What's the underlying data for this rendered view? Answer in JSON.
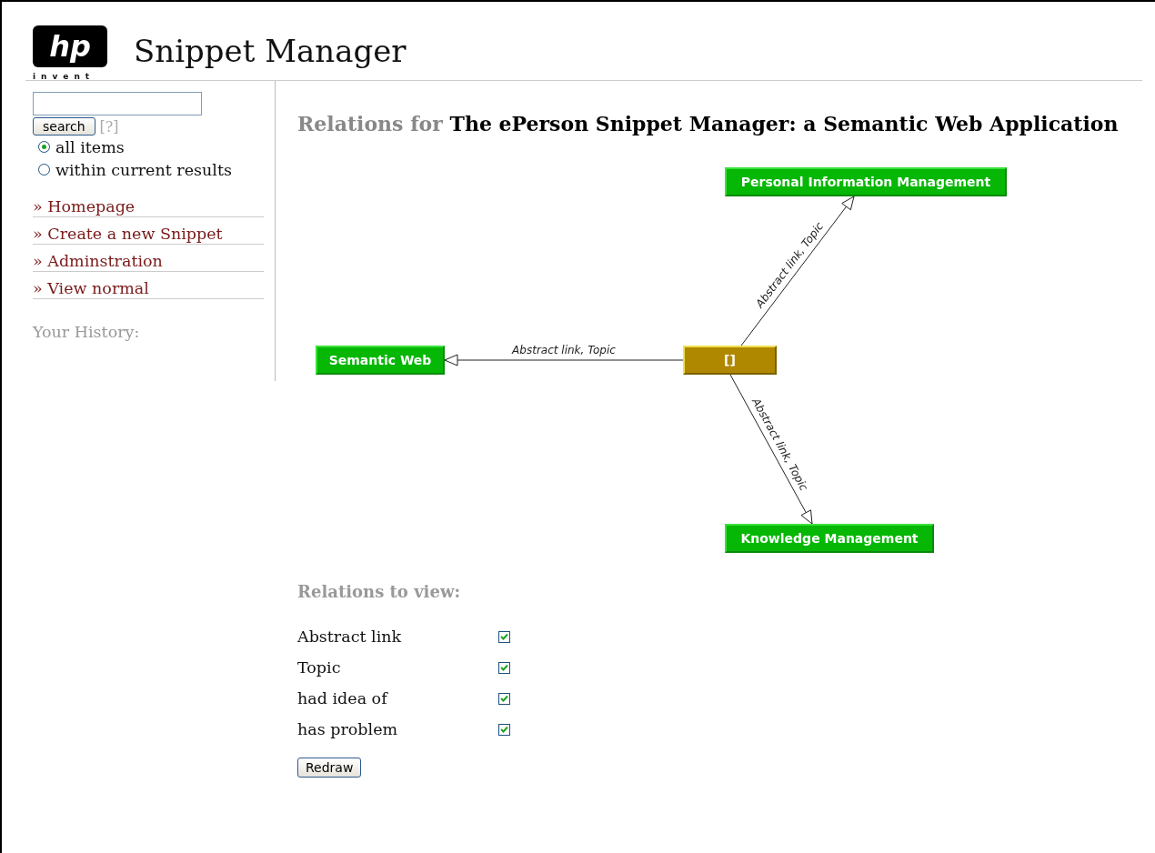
{
  "header": {
    "logo_mark": "hp",
    "logo_tagline": "invent",
    "title": "Snippet Manager"
  },
  "sidebar": {
    "search": {
      "button": "search",
      "help": "[?]"
    },
    "scope": [
      {
        "label": "all items",
        "selected": true
      },
      {
        "label": "within current results",
        "selected": false
      }
    ],
    "links": [
      "» Homepage",
      "» Create a new Snippet",
      "» Adminstration",
      "» View normal"
    ],
    "history_label": "Your History:"
  },
  "main": {
    "heading_prefix": "Relations for",
    "heading_title": "The ePerson Snippet Manager: a Semantic Web Application",
    "graph": {
      "nodes": [
        {
          "label": "[]",
          "kind": "current"
        },
        {
          "label": "Semantic Web",
          "kind": "topic"
        },
        {
          "label": "Personal Information Management",
          "kind": "topic"
        },
        {
          "label": "Knowledge Management",
          "kind": "topic"
        }
      ],
      "edges": [
        {
          "label": "Abstract link, Topic"
        },
        {
          "label": "Abstract link, Topic"
        },
        {
          "label": "Abstract link, Topic"
        }
      ]
    },
    "relations_heading": "Relations to view:",
    "relations": [
      {
        "label": "Abstract link",
        "checked": true
      },
      {
        "label": "Topic",
        "checked": true
      },
      {
        "label": "had idea of",
        "checked": true
      },
      {
        "label": "has problem",
        "checked": true
      }
    ],
    "redraw": "Redraw"
  }
}
